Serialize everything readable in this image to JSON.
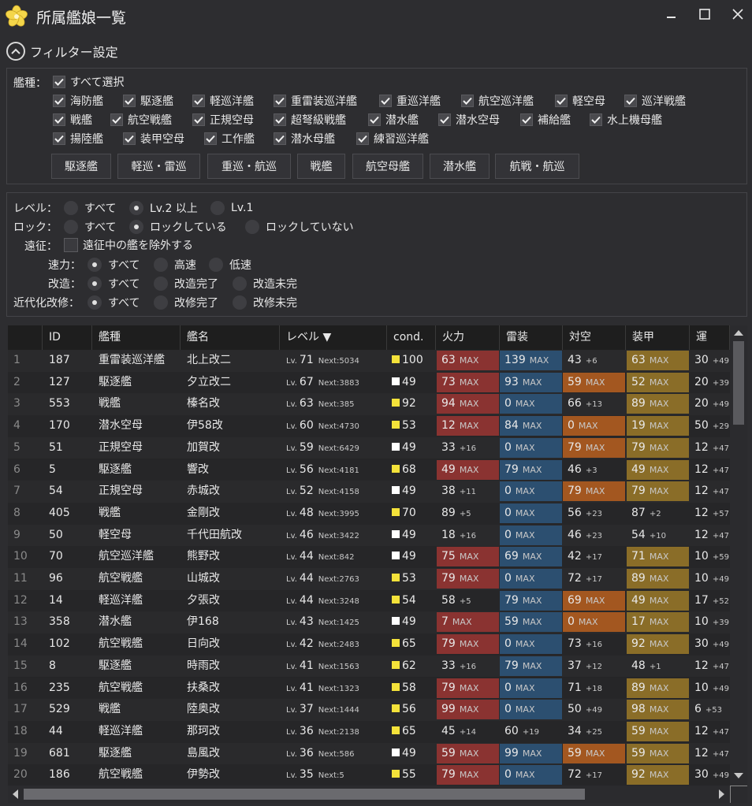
{
  "window": {
    "title": "所属艦娘一覧"
  },
  "filter": {
    "header": "フィルター設定",
    "ship_type_label": "艦種：",
    "select_all": "すべて選択",
    "types": [
      "海防艦",
      "駆逐艦",
      "軽巡洋艦",
      "重雷装巡洋艦",
      "重巡洋艦",
      "航空巡洋艦",
      "軽空母",
      "巡洋戦艦",
      "戦艦",
      "航空戦艦",
      "正規空母",
      "超弩級戦艦",
      "潜水艦",
      "潜水空母",
      "補給艦",
      "水上機母艦",
      "揚陸艦",
      "装甲空母",
      "工作艦",
      "潜水母艦",
      "練習巡洋艦"
    ],
    "preset_buttons": [
      "駆逐艦",
      "軽巡・雷巡",
      "重巡・航巡",
      "戦艦",
      "航空母艦",
      "潜水艦",
      "航戦・航巡"
    ],
    "level_label": "レベル：",
    "level_options": [
      "すべて",
      "Lv.2 以上",
      "Lv.1"
    ],
    "lock_label": "ロック：",
    "lock_options": [
      "すべて",
      "ロックしている",
      "ロックしていない"
    ],
    "expedition_label": "遠征：",
    "expedition_option": "遠征中の艦を除外する",
    "speed_label": "速力：",
    "speed_options": [
      "すべて",
      "高速",
      "低速"
    ],
    "remodel_label": "改造：",
    "remodel_options": [
      "すべて",
      "改造完了",
      "改造未完"
    ],
    "modernize_label": "近代化改修：",
    "modernize_options": [
      "すべて",
      "改修完了",
      "改修未完"
    ]
  },
  "grid": {
    "columns": [
      "ID",
      "艦種",
      "艦名",
      "レベル ▼",
      "cond.",
      "火力",
      "雷装",
      "対空",
      "装甲",
      "運"
    ],
    "lv_prefix": "Lv.",
    "next_prefix": "Next:",
    "max_label": "MAX",
    "colors": {
      "fire": "#8a3331",
      "torpedo": "#2c4f70",
      "aa": "#a35720",
      "armor": "#8a6d28",
      "cond_high": "#f4e23a",
      "cond_normal": "#ffffff"
    },
    "rows": [
      {
        "n": "1",
        "id": "187",
        "type": "重雷装巡洋艦",
        "name": "北上改二",
        "lv": "71",
        "next": "5034",
        "cond": "100",
        "cc": "y",
        "fp": "63",
        "fpm": "MAX",
        "tp": "139",
        "tpm": "MAX",
        "aa": "43",
        "aam": "+6",
        "ar": "63",
        "arm": "MAX",
        "lk": "30",
        "lkm": "+49"
      },
      {
        "n": "2",
        "id": "127",
        "type": "駆逐艦",
        "name": "夕立改二",
        "lv": "67",
        "next": "3883",
        "cond": "49",
        "cc": "w",
        "fp": "73",
        "fpm": "MAX",
        "tp": "93",
        "tpm": "MAX",
        "aa": "59",
        "aam": "MAX",
        "ar": "52",
        "arm": "MAX",
        "lk": "20",
        "lkm": "+39"
      },
      {
        "n": "3",
        "id": "553",
        "type": "戦艦",
        "name": "榛名改",
        "lv": "63",
        "next": "385",
        "cond": "92",
        "cc": "y",
        "fp": "94",
        "fpm": "MAX",
        "tp": "0",
        "tpm": "MAX",
        "aa": "66",
        "aam": "+13",
        "ar": "89",
        "arm": "MAX",
        "lk": "20",
        "lkm": "+49"
      },
      {
        "n": "4",
        "id": "170",
        "type": "潜水空母",
        "name": "伊58改",
        "lv": "60",
        "next": "4730",
        "cond": "53",
        "cc": "y",
        "fp": "12",
        "fpm": "MAX",
        "tp": "84",
        "tpm": "MAX",
        "aa": "0",
        "aam": "MAX",
        "ar": "19",
        "arm": "MAX",
        "lk": "50",
        "lkm": "+29"
      },
      {
        "n": "5",
        "id": "51",
        "type": "正規空母",
        "name": "加賀改",
        "lv": "59",
        "next": "6429",
        "cond": "49",
        "cc": "w",
        "fp": "33",
        "fpm": "+16",
        "tp": "0",
        "tpm": "MAX",
        "aa": "79",
        "aam": "MAX",
        "ar": "79",
        "arm": "MAX",
        "lk": "12",
        "lkm": "+47"
      },
      {
        "n": "6",
        "id": "5",
        "type": "駆逐艦",
        "name": "響改",
        "lv": "56",
        "next": "4181",
        "cond": "68",
        "cc": "y",
        "fp": "49",
        "fpm": "MAX",
        "tp": "79",
        "tpm": "MAX",
        "aa": "46",
        "aam": "+3",
        "ar": "49",
        "arm": "MAX",
        "lk": "12",
        "lkm": "+47"
      },
      {
        "n": "7",
        "id": "54",
        "type": "正規空母",
        "name": "赤城改",
        "lv": "52",
        "next": "4158",
        "cond": "49",
        "cc": "w",
        "fp": "38",
        "fpm": "+11",
        "tp": "0",
        "tpm": "MAX",
        "aa": "79",
        "aam": "MAX",
        "ar": "79",
        "arm": "MAX",
        "lk": "12",
        "lkm": "+47"
      },
      {
        "n": "8",
        "id": "405",
        "type": "戦艦",
        "name": "金剛改",
        "lv": "48",
        "next": "3995",
        "cond": "70",
        "cc": "y",
        "fp": "89",
        "fpm": "+5",
        "tp": "0",
        "tpm": "MAX",
        "aa": "56",
        "aam": "+23",
        "ar": "87",
        "arm": "+2",
        "lk": "12",
        "lkm": "+57"
      },
      {
        "n": "9",
        "id": "50",
        "type": "軽空母",
        "name": "千代田航改",
        "lv": "46",
        "next": "3422",
        "cond": "49",
        "cc": "w",
        "fp": "18",
        "fpm": "+16",
        "tp": "0",
        "tpm": "MAX",
        "aa": "46",
        "aam": "+23",
        "ar": "54",
        "arm": "+10",
        "lk": "12",
        "lkm": "+47"
      },
      {
        "n": "10",
        "id": "70",
        "type": "航空巡洋艦",
        "name": "熊野改",
        "lv": "44",
        "next": "842",
        "cond": "49",
        "cc": "w",
        "fp": "75",
        "fpm": "MAX",
        "tp": "69",
        "tpm": "MAX",
        "aa": "42",
        "aam": "+17",
        "ar": "71",
        "arm": "MAX",
        "lk": "10",
        "lkm": "+59"
      },
      {
        "n": "11",
        "id": "96",
        "type": "航空戦艦",
        "name": "山城改",
        "lv": "44",
        "next": "2763",
        "cond": "53",
        "cc": "y",
        "fp": "79",
        "fpm": "MAX",
        "tp": "0",
        "tpm": "MAX",
        "aa": "72",
        "aam": "+17",
        "ar": "89",
        "arm": "MAX",
        "lk": "10",
        "lkm": "+49"
      },
      {
        "n": "12",
        "id": "14",
        "type": "軽巡洋艦",
        "name": "夕張改",
        "lv": "44",
        "next": "3248",
        "cond": "54",
        "cc": "y",
        "fp": "58",
        "fpm": "+5",
        "tp": "79",
        "tpm": "MAX",
        "aa": "69",
        "aam": "MAX",
        "ar": "49",
        "arm": "MAX",
        "lk": "17",
        "lkm": "+52"
      },
      {
        "n": "13",
        "id": "358",
        "type": "潜水艦",
        "name": "伊168",
        "lv": "43",
        "next": "1425",
        "cond": "49",
        "cc": "w",
        "fp": "7",
        "fpm": "MAX",
        "tp": "59",
        "tpm": "MAX",
        "aa": "0",
        "aam": "MAX",
        "ar": "17",
        "arm": "MAX",
        "lk": "10",
        "lkm": "+39"
      },
      {
        "n": "14",
        "id": "102",
        "type": "航空戦艦",
        "name": "日向改",
        "lv": "42",
        "next": "2483",
        "cond": "65",
        "cc": "y",
        "fp": "79",
        "fpm": "MAX",
        "tp": "0",
        "tpm": "MAX",
        "aa": "73",
        "aam": "+16",
        "ar": "92",
        "arm": "MAX",
        "lk": "30",
        "lkm": "+49"
      },
      {
        "n": "15",
        "id": "8",
        "type": "駆逐艦",
        "name": "時雨改",
        "lv": "41",
        "next": "1563",
        "cond": "62",
        "cc": "y",
        "fp": "33",
        "fpm": "+16",
        "tp": "79",
        "tpm": "MAX",
        "aa": "37",
        "aam": "+12",
        "ar": "48",
        "arm": "+1",
        "lk": "12",
        "lkm": "+47"
      },
      {
        "n": "16",
        "id": "235",
        "type": "航空戦艦",
        "name": "扶桑改",
        "lv": "41",
        "next": "1323",
        "cond": "58",
        "cc": "y",
        "fp": "79",
        "fpm": "MAX",
        "tp": "0",
        "tpm": "MAX",
        "aa": "71",
        "aam": "+18",
        "ar": "89",
        "arm": "MAX",
        "lk": "10",
        "lkm": "+49"
      },
      {
        "n": "17",
        "id": "529",
        "type": "戦艦",
        "name": "陸奥改",
        "lv": "37",
        "next": "1444",
        "cond": "56",
        "cc": "y",
        "fp": "99",
        "fpm": "MAX",
        "tp": "0",
        "tpm": "MAX",
        "aa": "50",
        "aam": "+49",
        "ar": "98",
        "arm": "MAX",
        "lk": "6",
        "lkm": "+53"
      },
      {
        "n": "18",
        "id": "44",
        "type": "軽巡洋艦",
        "name": "那珂改",
        "lv": "36",
        "next": "2138",
        "cond": "65",
        "cc": "y",
        "fp": "45",
        "fpm": "+14",
        "tp": "60",
        "tpm": "+19",
        "aa": "34",
        "aam": "+25",
        "ar": "59",
        "arm": "MAX",
        "lk": "12",
        "lkm": "+47"
      },
      {
        "n": "19",
        "id": "681",
        "type": "駆逐艦",
        "name": "島風改",
        "lv": "36",
        "next": "586",
        "cond": "49",
        "cc": "w",
        "fp": "59",
        "fpm": "MAX",
        "tp": "99",
        "tpm": "MAX",
        "aa": "59",
        "aam": "MAX",
        "ar": "59",
        "arm": "MAX",
        "lk": "12",
        "lkm": "+47"
      },
      {
        "n": "20",
        "id": "186",
        "type": "航空戦艦",
        "name": "伊勢改",
        "lv": "35",
        "next": "5",
        "cond": "55",
        "cc": "y",
        "fp": "79",
        "fpm": "MAX",
        "tp": "0",
        "tpm": "MAX",
        "aa": "72",
        "aam": "+17",
        "ar": "92",
        "arm": "MAX",
        "lk": "30",
        "lkm": "+49"
      }
    ]
  }
}
